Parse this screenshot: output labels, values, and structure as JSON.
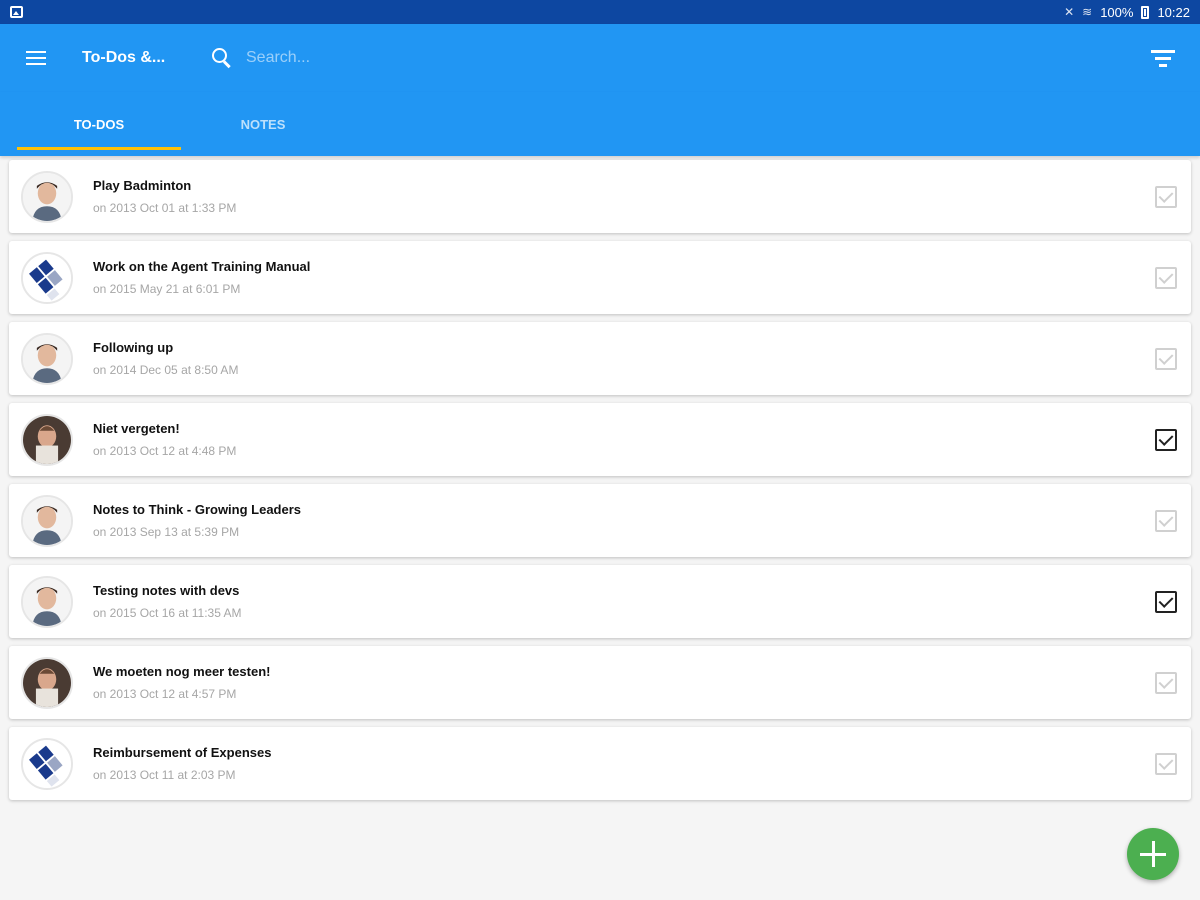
{
  "status_bar": {
    "battery": "100%",
    "time": "10:22"
  },
  "toolbar": {
    "title": "To-Dos &...",
    "search_placeholder": "Search..."
  },
  "tabs": [
    {
      "label": "TO-DOS",
      "active": true
    },
    {
      "label": "NOTES",
      "active": false
    }
  ],
  "items": [
    {
      "title": "Play Badminton",
      "date": "on 2013 Oct 01 at 1:33 PM",
      "avatar": "person",
      "checked": false
    },
    {
      "title": "Work on the Agent Training Manual",
      "date": "on 2015 May 21 at 6:01 PM",
      "avatar": "logo",
      "checked": false
    },
    {
      "title": "Following up",
      "date": "on 2014 Dec 05 at 8:50 AM",
      "avatar": "person",
      "checked": false
    },
    {
      "title": "Niet vergeten!",
      "date": "on 2013 Oct 12 at 4:48 PM",
      "avatar": "photo",
      "checked": true
    },
    {
      "title": "Notes to Think - Growing Leaders",
      "date": "on 2013 Sep 13 at 5:39 PM",
      "avatar": "person",
      "checked": false
    },
    {
      "title": "Testing notes with devs",
      "date": "on 2015 Oct 16 at 11:35 AM",
      "avatar": "person",
      "checked": true
    },
    {
      "title": "We moeten nog meer testen!",
      "date": "on 2013 Oct 12 at 4:57 PM",
      "avatar": "photo",
      "checked": false
    },
    {
      "title": "Reimbursement of Expenses",
      "date": "on 2013 Oct 11 at 2:03 PM",
      "avatar": "logo",
      "checked": false
    }
  ],
  "colors": {
    "status_bar": "#0d47a1",
    "primary": "#2196f3",
    "tab_indicator": "#ffc107",
    "fab": "#4caf50"
  },
  "icons": {
    "menu": "hamburger-menu-icon",
    "search": "search-icon",
    "filter": "filter-icon",
    "fab": "plus-icon"
  }
}
